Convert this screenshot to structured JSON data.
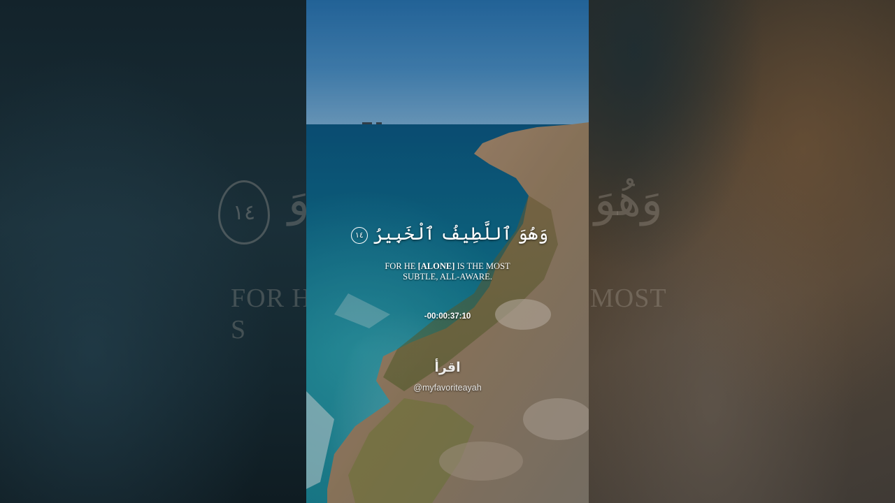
{
  "verse": {
    "arabic": "وَهُوَ ٱللَّطِيفُ ٱلْخَبِيرُ",
    "ayah_number": "١٤",
    "translation_prefix": "FOR HE ",
    "translation_emphasis": "[ALONE]",
    "translation_line1_rest": " IS THE MOST",
    "translation_line2": "SUBTLE, ALL-AWARE."
  },
  "timer": "-00:00:37:10",
  "brand": {
    "name": "اقرأ",
    "handle": "@myfavoriteayah"
  },
  "background": {
    "ghost_verse_left": "ﻭَ",
    "ghost_verse_right": "وَهُوَ",
    "ghost_medallion_number": "١٤",
    "ghost_trans_left": "FOR H",
    "ghost_trans_line2_left": "S",
    "ghost_trans_right": "MOST"
  },
  "colors": {
    "sky": "#4b93cc",
    "sea": "#0f7395",
    "text": "#ffffff"
  }
}
